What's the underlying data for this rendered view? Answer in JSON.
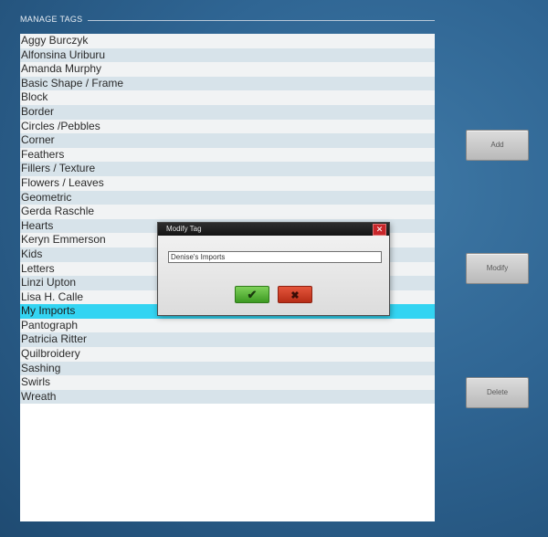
{
  "header": {
    "title": "MANAGE TAGS"
  },
  "tags": [
    "Aggy Burczyk",
    "Alfonsina Uriburu",
    "Amanda Murphy",
    "Basic Shape / Frame",
    "Block",
    "Border",
    "Circles /Pebbles",
    "Corner",
    "Feathers",
    "Fillers / Texture",
    "Flowers / Leaves",
    "Geometric",
    "Gerda Raschle",
    "Hearts",
    "Keryn Emmerson",
    "Kids",
    "Letters",
    "Linzi Upton",
    "Lisa H. Calle",
    "My Imports",
    "Pantograph",
    "Patricia Ritter",
    "Quilbroidery",
    "Sashing",
    "Swirls",
    "Wreath"
  ],
  "selected_tag": "My Imports",
  "buttons": {
    "add": "Add",
    "modify": "Modify",
    "delete": "Delete"
  },
  "dialog": {
    "title": "Modify Tag",
    "close_icon": "close-icon",
    "input_value": "Denise's Imports",
    "ok_icon": "check-icon",
    "cancel_icon": "x-icon"
  },
  "colors": {
    "selected_row": "#33d4f2",
    "row_odd": "#f1f3f4",
    "row_even": "#d7e3ea",
    "ok_button": "#4fb42e",
    "cancel_button": "#c93a22",
    "close_button": "#c8262a"
  }
}
